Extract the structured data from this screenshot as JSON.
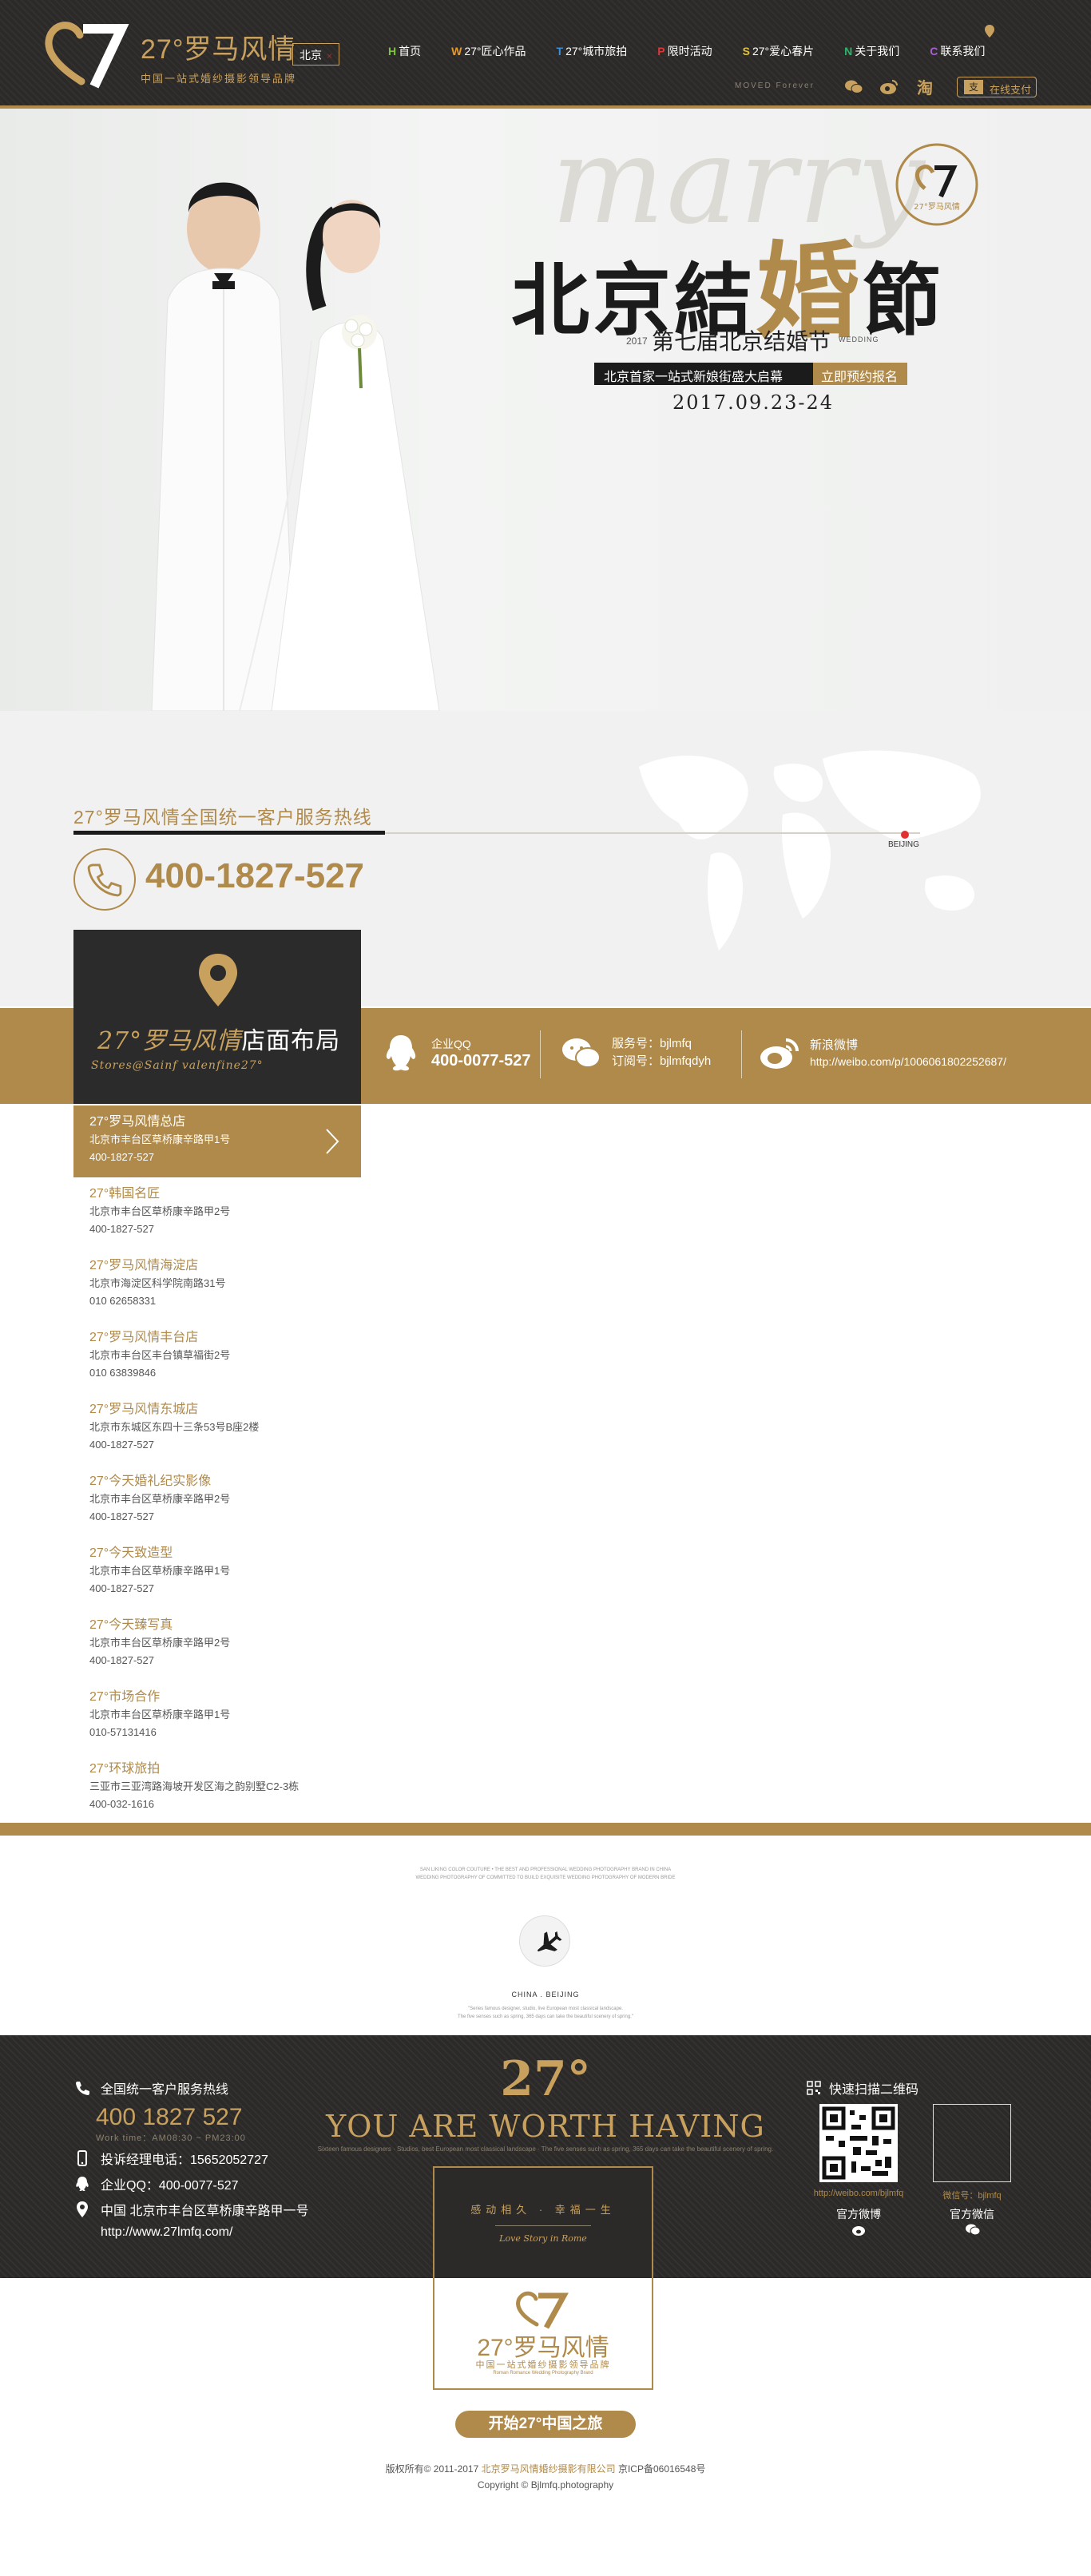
{
  "header": {
    "logo_num": "27°",
    "logo_name": "罗马风情",
    "logo_sub": "中国一站式婚纱摄影领导品牌",
    "city": "北京",
    "city_close": "×",
    "nav": [
      {
        "letter": "H",
        "label": "首页",
        "color": "#7fc241"
      },
      {
        "letter": "W",
        "label": "27°匠心作品",
        "color": "#e59a2b"
      },
      {
        "letter": "T",
        "label": "27°城市旅拍",
        "color": "#3a8fd8"
      },
      {
        "letter": "P",
        "label": "限时活动",
        "color": "#d83a3a"
      },
      {
        "letter": "S",
        "label": "27°爱心春片",
        "color": "#e2c234"
      },
      {
        "letter": "N",
        "label": "关于我们",
        "color": "#2fb36a"
      },
      {
        "letter": "C",
        "label": "联系我们",
        "color": "#a960d4"
      }
    ],
    "slogan": "MOVED Forever",
    "pay_label": "在线支付",
    "pay_icon": "支",
    "social": [
      "wechat-icon",
      "weibo-icon",
      "taobao-icon"
    ]
  },
  "hero": {
    "script": "marry",
    "title_a": "北京結",
    "title_hl": "婚",
    "title_b": "節",
    "badge_num": "27",
    "badge_name": "27°罗马风情",
    "year": "2017",
    "subtitle": "第七届北京结婚节",
    "wedding": "WEDDING",
    "band_left": "北京首家一站式新娘街盛大启幕",
    "band_right": "立即预约报名",
    "date": "2017.09.23-24"
  },
  "hotline": {
    "title": "27°罗马风情全国统一客户服务热线",
    "beijing": "BEIJING",
    "phone": "400-1827-527"
  },
  "stores_header": {
    "title_a": "27°罗马风情",
    "title_b": "店面布局",
    "subtitle": "Stores@Sainf valenfine27°"
  },
  "contacts": {
    "qq_label": "企业QQ",
    "qq_value": "400-0077-527",
    "service": "服务号：bjlmfq",
    "subscribe": "订阅号：bjlmfqdyh",
    "weibo_label": "新浪微博",
    "weibo_url": "http://weibo.com/p/1006061802252687/"
  },
  "stores": [
    {
      "name": "27°罗马风情总店",
      "addr": "北京市丰台区草桥康辛路甲1号",
      "phone": "400-1827-527"
    },
    {
      "name": "27°韩国名匠",
      "addr": "北京市丰台区草桥康辛路甲2号",
      "phone": "400-1827-527"
    },
    {
      "name": "27°罗马风情海淀店",
      "addr": "北京市海淀区科学院南路31号",
      "phone": "010 62658331"
    },
    {
      "name": "27°罗马风情丰台店",
      "addr": "北京市丰台区丰台镇草福街2号",
      "phone": "010 63839846"
    },
    {
      "name": "27°罗马风情东城店",
      "addr": "北京市东城区东四十三条53号B座2楼",
      "phone": "400-1827-527"
    },
    {
      "name": "27°今天婚礼纪实影像",
      "addr": "北京市丰台区草桥康辛路甲2号",
      "phone": "400-1827-527"
    },
    {
      "name": "27°今天致造型",
      "addr": "北京市丰台区草桥康辛路甲1号",
      "phone": "400-1827-527"
    },
    {
      "name": "27°今天臻写真",
      "addr": "北京市丰台区草桥康辛路甲2号",
      "phone": "400-1827-527"
    },
    {
      "name": "27°市场合作",
      "addr": "北京市丰台区草桥康辛路甲1号",
      "phone": "010-57131416"
    },
    {
      "name": "27°环球旅拍",
      "addr": "三亚市三亚湾路海坡开发区海之韵别墅C2-3栋",
      "phone": "400-032-1616"
    }
  ],
  "mid": {
    "line1": "SAN LIKING COLOR COUTURE • THE BEST AND PROFESSIONAL WEDDING PHOTOGRAPHY BRAND IN CHINA",
    "line2": "WEDDING PHOTOGRAPHY OF COMMITTED TO BUILD EXQUISITE WEDDING PHOTOGRAPHY OF MODERN BRIDE",
    "china_beijing": "CHINA . BEIJING",
    "line3": "\"Series famous designer, studio, live European most classical landscape.",
    "line4": "The five senses such as spring, 365 days can take the beautiful scenery of spring.\""
  },
  "footer": {
    "hotline_label": "全国统一客户服务热线",
    "hotline": "400 1827 527",
    "work_time": "Work time：AM08:30 ~ PM23:00",
    "complaint": "投诉经理电话：15652052727",
    "qq": "企业QQ：400-0077-527",
    "address": "中国  北京市丰台区草桥康辛路甲一号",
    "site": "http://www.27lmfq.com/",
    "big_num": "27°",
    "worth": "YOU ARE WORTH HAVING",
    "worth_sub": "Sixteen famous designers · Studios, best European most classical landscape · The five senses such as spring, 365 days can take the beautiful scenery of spring.",
    "card_line1": "感动相久 · 幸福一生",
    "card_line2": "Love Story in Rome",
    "card_name": "27°罗马风情",
    "card_sub": "中国一站式婚纱摄影领导品牌",
    "card_sub2": "Roman Romance Wedding Photography Brand",
    "qr_title": "快速扫描二维码",
    "qr1_url": "http://weibo.com/bjlmfq",
    "qr1_label": "官方微博",
    "qr2_url": "微信号：bjlmfq",
    "qr2_label": "官方微信",
    "start": "开始27°中国之旅",
    "copy1_a": "版权所有© 2011-2017 ",
    "copy1_link": "北京罗马风情婚纱摄影有限公司",
    "copy1_b": " 京ICP备06016548号",
    "copy2": "Copyright © Bjlmfq.photography"
  },
  "colors": {
    "gold": "#b08a4a",
    "dark": "#2c2a28",
    "accent_red": "#e23030"
  }
}
